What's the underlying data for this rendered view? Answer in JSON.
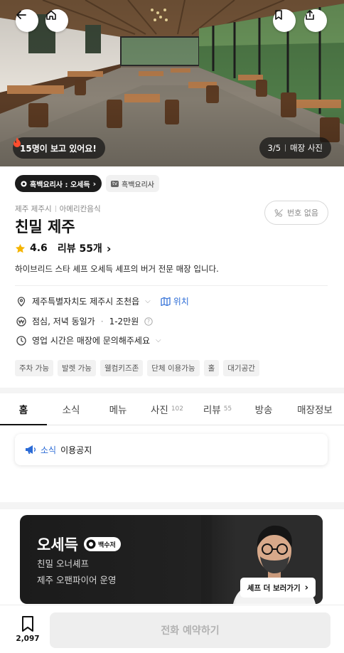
{
  "hero": {
    "watching_text": "15명이 보고 있어요!",
    "photo_index": "3/5",
    "photo_label": "매장 사진"
  },
  "badges": {
    "primary": "흑백요리사 : 오세득",
    "secondary": "흑백요리사"
  },
  "category": {
    "region": "제주 제주시",
    "cuisine": "아메리칸음식"
  },
  "title": "친밀 제주",
  "rating": {
    "score": "4.6",
    "review_text": "리뷰 55개"
  },
  "phone_button": "번호 없음",
  "description": "하이브리드 스타 셰프 오세득 셰프의 버거 전문 매장 입니다.",
  "details": {
    "address": "제주특별자치도 제주시 조천읍",
    "location_link": "위치",
    "meal": "점심, 저녁 동일가",
    "price": "1-2만원",
    "hours": "영업 시간은 매장에 문의해주세요"
  },
  "tags": [
    "주차 가능",
    "발렛 가능",
    "웰컴키즈존",
    "단체 이용가능",
    "홀",
    "대기공간"
  ],
  "tabs": [
    {
      "label": "홈",
      "count": ""
    },
    {
      "label": "소식",
      "count": ""
    },
    {
      "label": "메뉴",
      "count": ""
    },
    {
      "label": "사진",
      "count": "102"
    },
    {
      "label": "리뷰",
      "count": "55"
    },
    {
      "label": "방송",
      "count": ""
    },
    {
      "label": "매장정보",
      "count": ""
    }
  ],
  "notice": {
    "tag": "소식",
    "text": "이용공지"
  },
  "chef": {
    "name": "오세득",
    "badge": "백수저",
    "line1": "친밀 오너셰프",
    "line2": "제주 오팬파이어 운영",
    "more_button": "셰프 더 보러가기"
  },
  "bottom": {
    "save_count": "2,097",
    "call_button": "전화 예약하기"
  },
  "colors": {
    "accent_blue": "#2b6bd6",
    "star": "#f5b400",
    "dark_badge": "#1c1c1c"
  }
}
